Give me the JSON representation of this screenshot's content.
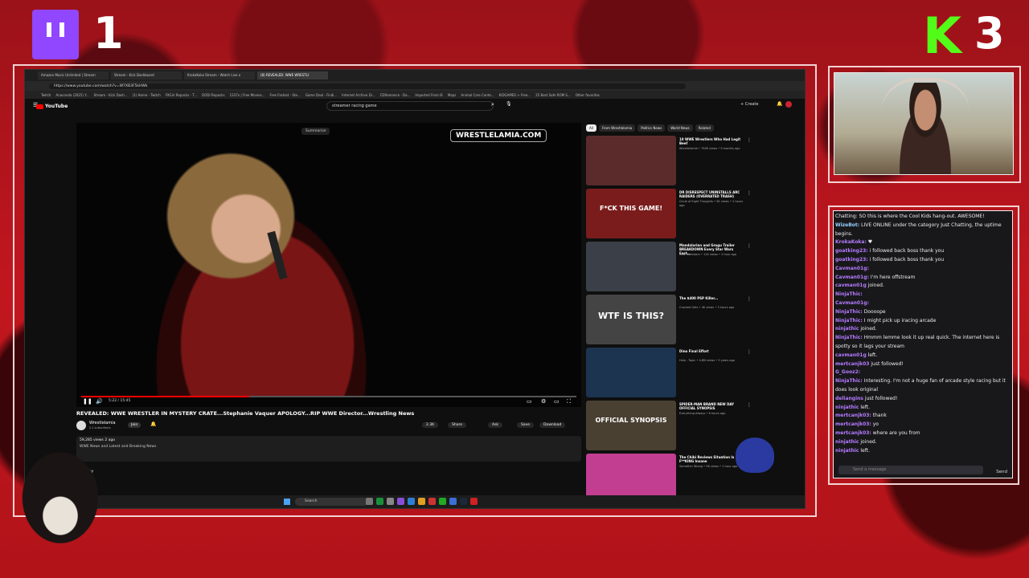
{
  "overlay": {
    "twitch_count": "1",
    "kick_count": "3"
  },
  "browser": {
    "tabs": [
      {
        "label": "Amazon Music Unlimited | Stream",
        "active": false
      },
      {
        "label": "Stream - Kick Dashboard",
        "active": false
      },
      {
        "label": "KrokaKoka Stream - Watch Live o",
        "active": false
      },
      {
        "label": "(8) REVEALED: WWE WRESTLI",
        "active": true
      }
    ],
    "url": "https://www.youtube.com/watch?v=W7XB3F5kHWk",
    "bookmarks": [
      "Twitch",
      "Anaconda (2025) Y...",
      "Stream - Kick Dash...",
      "(1) Home - Twitch",
      "FitGirl Repacks - T...",
      "DODI Repacks",
      "1337x | Free Movies...",
      "Free Fastest - Ste...",
      "Game Deal - Findi...",
      "Internet Archive Di...",
      "CDRomance - Da...",
      "Imported From IE",
      "Maps",
      "Animal Care Cente...",
      "KIDGAMES > Free...",
      "25 Best Safe ROM S...",
      "Other favorites"
    ]
  },
  "youtube": {
    "logo": "YouTube",
    "search_value": "streamer racing game",
    "create_label": "+ Create",
    "summarize_label": "Summarize",
    "watermark": "WRESTLELAMIA.COM",
    "progress": 0.34,
    "time_label": "5:22 / 15:45",
    "video_title": "REVEALED: WWE WRESTLER IN MYSTERY CRATE...Stephanie Vaquer APOLOGY...RIP WWE Director...Wrestling News",
    "channel_name": "Wrestlelamia",
    "channel_subs": "2.1 subscribers",
    "join_label": "Join",
    "actions": [
      "2.3K",
      "Share",
      "Ask",
      "Save",
      "Download"
    ],
    "desc_views": "59,285 views  2 ago",
    "desc_text": "WWE News and Latest and Breaking News",
    "comments_label": "Sort by",
    "chips": [
      "All",
      "From Wrestlelamia",
      "Politics News",
      "World News",
      "Related"
    ],
    "recommendations": [
      {
        "title": "10 WWE Wrestlers Who Had Legit Beef",
        "meta": "Wrestlelamia • 794K views • 9 months ago",
        "thumb_text": "",
        "color": "#5b2b2b"
      },
      {
        "title": "DR DISRESPECT UNINSTALLS ARC RAIDERS (OVERRATED TRASH)",
        "meta": "Circle of Eight Thoughts • 5K views • 2 hours ago",
        "thumb_text": "F*CK THIS GAME!",
        "color": "#7a1c1c"
      },
      {
        "title": "Mandalorian and Grogu Trailer BREAKDOWN Every Star Wars East...",
        "meta": "New Rockstars • 11K views • 1 hour ago",
        "thumb_text": "",
        "color": "#3a3f48"
      },
      {
        "title": "The $400 PSP Killer...",
        "meta": "Cracked Gets • 4K views • 3 hours ago",
        "thumb_text": "WTF IS THIS?",
        "color": "#444"
      },
      {
        "title": "Dino Final Effort",
        "meta": "Halo - Topic • 4.8M views • 3 years ago",
        "thumb_text": "",
        "color": "#1c3450"
      },
      {
        "title": "SPIDER-MAN BRAND NEW DAY OFFICIAL SYNOPSIS",
        "meta": "Everything Always • 6 hours ago",
        "thumb_text": "OFFICIAL SYNOPSIS",
        "color": "#4a4032"
      },
      {
        "title": "The Chibi Reviews Situation Is F**KING Insane",
        "meta": "Somethin Wrong • 5K views • 1 hour ago",
        "thumb_text": "",
        "color": "#c23e91"
      }
    ],
    "taskbar_search": "Search"
  },
  "chat": {
    "messages": [
      {
        "user": "",
        "text": "Chatting: SO this is where the Cool Kids hang-out. AWESOME!",
        "color": "#eee",
        "wrap": false
      },
      {
        "user": "WizeBot:",
        "text": "LIVE ONLINE under the category Just Chatting, the uptime begins.",
        "color": "#9ad0ff",
        "wrap": true
      },
      {
        "user": "KrokaKoka:",
        "text": "♥",
        "color": "#b57bff",
        "wrap": false
      },
      {
        "user": "goatking23:",
        "text": "i followed back boss thank you",
        "color": "#b57bff",
        "wrap": false
      },
      {
        "user": "goatking23:",
        "text": "i followed back boss thank you",
        "color": "#b57bff",
        "wrap": false
      },
      {
        "user": "Cavman01g:",
        "text": "",
        "color": "#b57bff",
        "wrap": false
      },
      {
        "user": "Cavman01g:",
        "text": "I'm here offstream",
        "color": "#b57bff",
        "wrap": false
      },
      {
        "user": "cavman01g",
        "text": "joined.",
        "color": "#b57bff",
        "wrap": false
      },
      {
        "user": "NinjaThic:",
        "text": "",
        "color": "#b57bff",
        "wrap": false
      },
      {
        "user": "Cavman01g:",
        "text": "",
        "color": "#b57bff",
        "wrap": false
      },
      {
        "user": "NinjaThic:",
        "text": "Doooope",
        "color": "#b57bff",
        "wrap": false
      },
      {
        "user": "NinjaThic:",
        "text": "I might pick up iracing arcade",
        "color": "#b57bff",
        "wrap": false
      },
      {
        "user": "ninjathic",
        "text": "joined.",
        "color": "#b57bff",
        "wrap": false
      },
      {
        "user": "NinjaThic:",
        "text": "Hmmm lemme look it up real quick. The internet here is spotty so it lags your stream",
        "color": "#b57bff",
        "wrap": true
      },
      {
        "user": "cavman01g",
        "text": "left.",
        "color": "#b57bff",
        "wrap": false
      },
      {
        "user": "mertcanjk03",
        "text": "just followed!",
        "color": "#b57bff",
        "wrap": false
      },
      {
        "user": "G_Gooz2:",
        "text": "",
        "color": "#b57bff",
        "wrap": false
      },
      {
        "user": "NinjaThic:",
        "text": "Interesting. I'm not a huge fan of arcade style racing but it does look original",
        "color": "#b57bff",
        "wrap": true
      },
      {
        "user": "deliangins",
        "text": "just followed!",
        "color": "#b57bff",
        "wrap": false
      },
      {
        "user": "ninjathic",
        "text": "left.",
        "color": "#b57bff",
        "wrap": false
      },
      {
        "user": "mertcanjk03:",
        "text": "thank",
        "color": "#b57bff",
        "wrap": false
      },
      {
        "user": "mertcanjk03:",
        "text": "yo",
        "color": "#b57bff",
        "wrap": false
      },
      {
        "user": "mertcanjk03:",
        "text": "where are you from",
        "color": "#b57bff",
        "wrap": false
      },
      {
        "user": "ninjathic",
        "text": "joined.",
        "color": "#b57bff",
        "wrap": false
      },
      {
        "user": "ninjathic",
        "text": "left.",
        "color": "#b57bff",
        "wrap": false
      }
    ],
    "input_placeholder": "Send a message",
    "send_label": "Send"
  }
}
